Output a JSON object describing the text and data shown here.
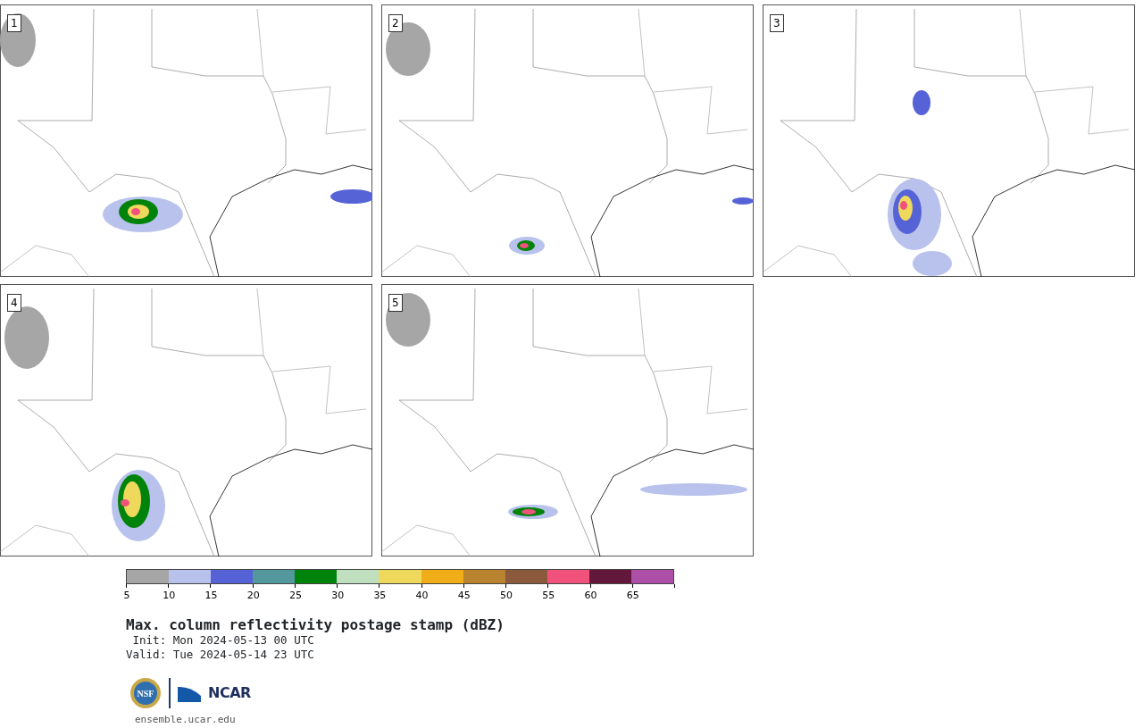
{
  "panels": [
    {
      "label": "1"
    },
    {
      "label": "2"
    },
    {
      "label": "3"
    },
    {
      "label": "4"
    },
    {
      "label": "5"
    }
  ],
  "colorbar": {
    "bins": [
      {
        "color": "#a6a6a6"
      },
      {
        "color": "#b8c2ec"
      },
      {
        "color": "#5563d6"
      },
      {
        "color": "#53989c"
      },
      {
        "color": "#00830a"
      },
      {
        "color": "#bfdfbf"
      },
      {
        "color": "#efd95c"
      },
      {
        "color": "#efad17"
      },
      {
        "color": "#b8822e"
      },
      {
        "color": "#8b5a3c"
      },
      {
        "color": "#f0527c"
      },
      {
        "color": "#63173a"
      },
      {
        "color": "#ad4ea8"
      }
    ],
    "tick_labels": [
      "5",
      "10",
      "15",
      "20",
      "25",
      "30",
      "35",
      "40",
      "45",
      "50",
      "55",
      "60",
      "65"
    ]
  },
  "title": "Max. column reflectivity postage stamp (dBZ)",
  "init": " Init: Mon 2024-05-13 00 UTC",
  "valid": "Valid: Tue 2024-05-14 23 UTC",
  "logo": {
    "seal_text": "NSF",
    "wordmark": "NCAR"
  },
  "site": "ensemble.ucar.edu"
}
